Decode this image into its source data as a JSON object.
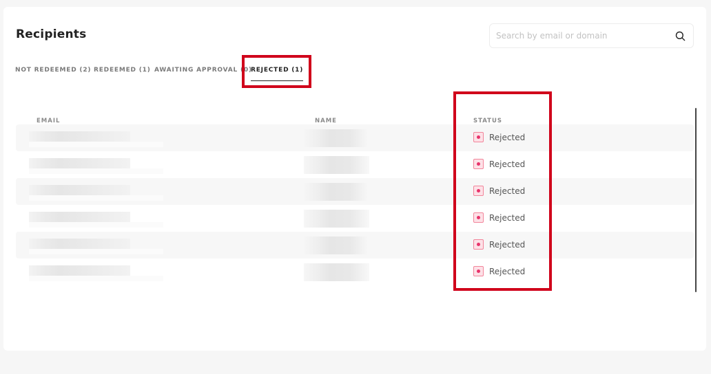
{
  "header": {
    "title": "Recipients"
  },
  "search": {
    "placeholder": "Search by email or domain"
  },
  "tabs": [
    {
      "label": "NOT REDEEMED (2)"
    },
    {
      "label": "REDEEMED (1)"
    },
    {
      "label": "AWAITING APPROVAL (0)"
    },
    {
      "label": "REJECTED (1)"
    }
  ],
  "table": {
    "columns": [
      "EMAIL",
      "NAME",
      "STATUS"
    ],
    "rows": [
      {
        "status": "Rejected"
      },
      {
        "status": "Rejected"
      },
      {
        "status": "Rejected"
      },
      {
        "status": "Rejected"
      },
      {
        "status": "Rejected"
      },
      {
        "status": "Rejected"
      }
    ]
  },
  "colors": {
    "highlight": "#d0021b",
    "status_rejected": "#e8336b"
  },
  "icons": {
    "search": "search-icon",
    "status": "rejected-status-icon"
  }
}
